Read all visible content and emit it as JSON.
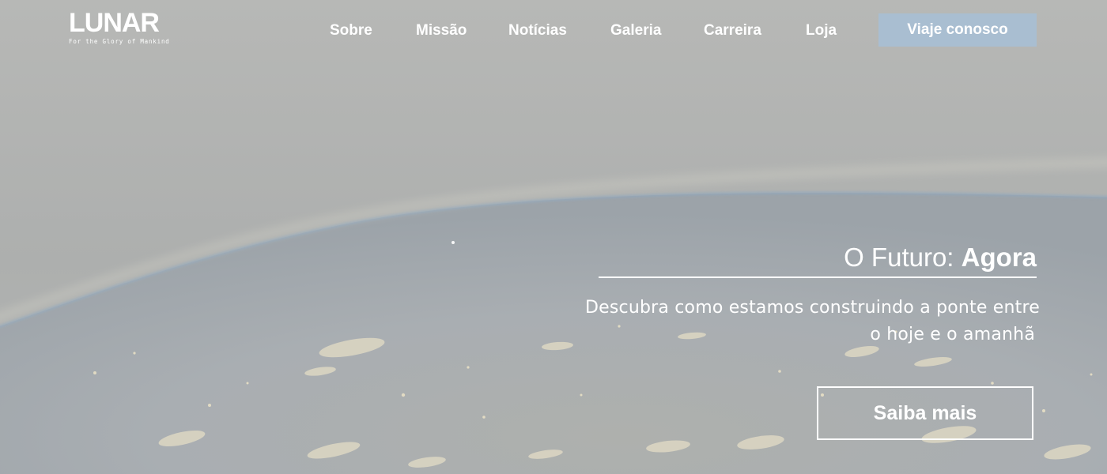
{
  "brand": {
    "name": "LUNAR",
    "tagline": "For the Glory of Mankind"
  },
  "nav": {
    "items": [
      {
        "label": "Sobre"
      },
      {
        "label": "Missão"
      },
      {
        "label": "Notícias"
      },
      {
        "label": "Galeria"
      },
      {
        "label": "Carreira"
      },
      {
        "label": "Loja"
      }
    ],
    "cta_label": "Viaje conosco"
  },
  "hero": {
    "title_prefix": "O Futuro: ",
    "title_emphasis": "Agora",
    "subtitle_line_1": "Descubra como estamos construindo a ponte entre",
    "subtitle_line_2": "o hoje e o amanhã",
    "button_label": "Saiba mais"
  },
  "colors": {
    "overlay": "#b4b6b4",
    "cta_background": "#a9bed1",
    "text": "#ffffff"
  }
}
